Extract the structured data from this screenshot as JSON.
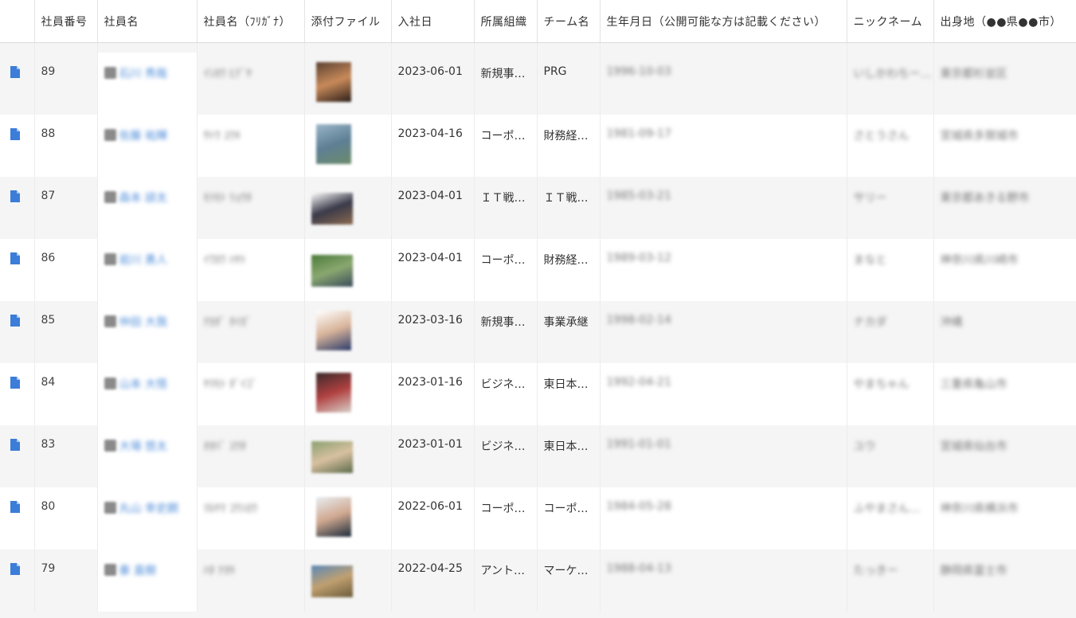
{
  "columns": [
    {
      "key": "icon",
      "label": ""
    },
    {
      "key": "emp_no",
      "label": "社員番号"
    },
    {
      "key": "name",
      "label": "社員名"
    },
    {
      "key": "kana",
      "label": "社員名（ﾌﾘｶﾞﾅ）"
    },
    {
      "key": "file",
      "label": "添付ファイル"
    },
    {
      "key": "joined",
      "label": "入社日"
    },
    {
      "key": "org",
      "label": "所属組織"
    },
    {
      "key": "team",
      "label": "チーム名"
    },
    {
      "key": "birth",
      "label": "生年月日（公開可能な方は記載ください）"
    },
    {
      "key": "nick",
      "label": "ニックネーム"
    },
    {
      "key": "hometown",
      "label": "出身地（●●県●●市）"
    }
  ],
  "rows": [
    {
      "emp_no": "89",
      "name": "石川 秀哉",
      "kana": "ｲｼｶﾜ ﾋﾃﾞﾔ",
      "joined": "2023-06-01",
      "org": "新規事…",
      "team": "PRG",
      "birth": "1996-10-03",
      "nick": "いしかわちー…",
      "hometown": "東京都杉並区",
      "thumb_colors": [
        "#5a4030",
        "#c88a5a",
        "#2a1e18"
      ]
    },
    {
      "emp_no": "88",
      "name": "佐藤 祐輝",
      "kana": "ｻﾄｳ ﾕｳｷ",
      "joined": "2023-04-16",
      "org": "コーポ…",
      "team": "財務経…",
      "birth": "1981-09-17",
      "nick": "さとうさん",
      "hometown": "宮城県多賀城市",
      "thumb_colors": [
        "#9bb6c8",
        "#5e7f95",
        "#6b8b6a"
      ]
    },
    {
      "emp_no": "87",
      "name": "森本 諒太",
      "kana": "ﾓﾘﾓﾄ ﾘｮｳﾀ",
      "joined": "2023-04-01",
      "org": "ＩＴ戦…",
      "team": "ＩＴ戦…",
      "birth": "1985-03-21",
      "nick": "サリー",
      "hometown": "東京都あきる野市",
      "thumb_colors": [
        "#ffffff",
        "#3a3a4a",
        "#8a6a50"
      ],
      "wide": true
    },
    {
      "emp_no": "86",
      "name": "岩川 勇人",
      "kana": "ｲﾜｶﾜ ﾊﾔﾄ",
      "joined": "2023-04-01",
      "org": "コーポ…",
      "team": "財務経…",
      "birth": "1989-03-12",
      "nick": "まなと",
      "hometown": "神奈川県川崎市",
      "thumb_colors": [
        "#4a7a3a",
        "#8aa870",
        "#3a4a5a"
      ],
      "wide": true
    },
    {
      "emp_no": "85",
      "name": "仲田 大我",
      "kana": "ﾅｶﾀﾞ ﾀｲｶﾞ",
      "joined": "2023-03-16",
      "org": "新規事…",
      "team": "事業承継",
      "birth": "1998-02-14",
      "nick": "ナカダ",
      "hometown": "沖縄",
      "thumb_colors": [
        "#ffffff",
        "#d8b49a",
        "#2a3a6a"
      ]
    },
    {
      "emp_no": "84",
      "name": "山本 大悟",
      "kana": "ﾔﾏﾓﾄ ﾀﾞｲｺﾞ",
      "joined": "2023-01-16",
      "org": "ビジネ…",
      "team": "東日本…",
      "birth": "1992-04-21",
      "nick": "やまちゃん",
      "hometown": "三重県亀山市",
      "thumb_colors": [
        "#3a2a2a",
        "#b04040",
        "#d8d0c8"
      ]
    },
    {
      "emp_no": "83",
      "name": "大場 悠太",
      "kana": "ｵｵﾊﾞ ﾕｳﾀ",
      "joined": "2023-01-01",
      "org": "ビジネ…",
      "team": "東日本…",
      "birth": "1991-01-01",
      "nick": "ユウ",
      "hometown": "宮城県仙台市",
      "thumb_colors": [
        "#8aa070",
        "#d8c0a0",
        "#5a6a4a"
      ],
      "wide": true
    },
    {
      "emp_no": "80",
      "name": "丸山 幸史朗",
      "kana": "ﾏﾙﾔﾏ ｺｳｼﾛｳ",
      "joined": "2022-06-01",
      "org": "コーポ…",
      "team": "コーポ…",
      "birth": "1984-05-28",
      "nick": "ふやまさん…",
      "hometown": "神奈川県横浜市",
      "thumb_colors": [
        "#e8eef2",
        "#d0a890",
        "#1a2a3a"
      ]
    },
    {
      "emp_no": "79",
      "name": "秦 直樹",
      "kana": "ﾊﾀ ﾅｵｷ",
      "joined": "2022-04-25",
      "org": "アント…",
      "team": "マーケ…",
      "birth": "1988-04-13",
      "nick": "たっきー",
      "hometown": "静岡県富士市",
      "thumb_colors": [
        "#5a88b8",
        "#c0a070",
        "#6a5a3a"
      ],
      "wide": true
    }
  ],
  "icons": {
    "record": "document-icon"
  },
  "colors": {
    "link": "#4a8ad8",
    "icon": "#3b7dd8",
    "stripe": "#f5f5f5"
  }
}
